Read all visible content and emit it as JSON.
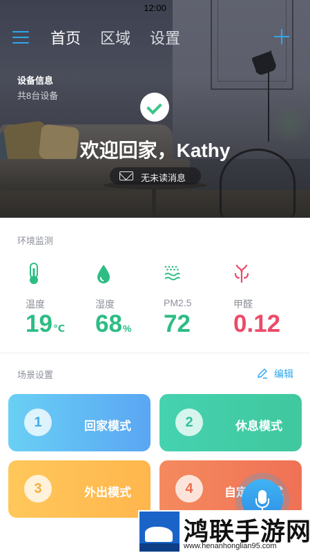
{
  "status_bar": {
    "time": "12:00"
  },
  "nav": {
    "tabs": [
      {
        "label": "首页",
        "active": true
      },
      {
        "label": "区域",
        "active": false
      },
      {
        "label": "设置",
        "active": false
      }
    ],
    "menu_icon": "hamburger-menu-icon",
    "add_icon": "plus-icon"
  },
  "hero": {
    "device_title": "设备信息",
    "device_count": "共8台设备",
    "welcome": "欢迎回家，Kathy",
    "messages": "无未读消息"
  },
  "environment": {
    "title": "环境监测",
    "items": [
      {
        "icon": "thermometer-icon",
        "label": "温度",
        "value": "19",
        "unit": "℃",
        "color": "#2dbd84"
      },
      {
        "icon": "water-drop-icon",
        "label": "湿度",
        "value": "68",
        "unit": "%",
        "color": "#2dbd84"
      },
      {
        "icon": "air-wave-icon",
        "label": "PM2.5",
        "value": "72",
        "unit": "",
        "color": "#2dbd84"
      },
      {
        "icon": "formaldehyde-icon",
        "label": "甲醛",
        "value": "0.12",
        "unit": "",
        "color": "#ec4a68"
      }
    ]
  },
  "scenes": {
    "title": "场景设置",
    "edit_label": "编辑",
    "items": [
      {
        "number": "1",
        "label": "回家模式"
      },
      {
        "number": "2",
        "label": "休息模式"
      },
      {
        "number": "3",
        "label": "外出模式"
      },
      {
        "number": "4",
        "label": "自定义模式"
      }
    ]
  },
  "voice_button": {
    "icon": "microphone-icon"
  },
  "watermark": {
    "title": "鸿联手游网",
    "url": "www.henanhonglian95.com"
  },
  "colors": {
    "accent": "#2fa7ee",
    "good": "#2dbd84",
    "warning": "#ec4a68"
  }
}
